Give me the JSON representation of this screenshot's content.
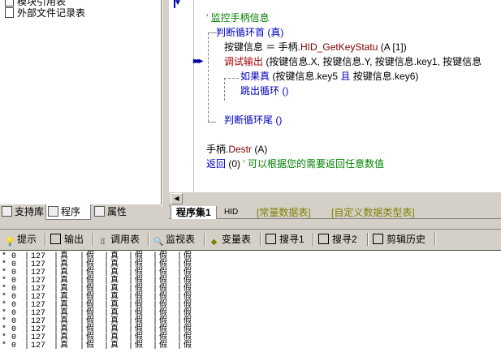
{
  "tree": {
    "items": [
      "模块引用表",
      "外部文件记录表"
    ]
  },
  "left_tabs": [
    {
      "label": "支持库",
      "icon": "support-library-icon"
    },
    {
      "label": "程序",
      "icon": "program-icon"
    },
    {
      "label": "属性",
      "icon": "property-icon"
    }
  ],
  "code": {
    "comment1": "' 监控手柄信息",
    "loop_head": "判断循环首 (真)",
    "line_assign_a": "按键信息 ＝ 手柄.",
    "line_assign_b": "HID_GetKeyStatu",
    "line_assign_c": " (A [1])",
    "debug_a": "调试输出",
    "debug_b": " (按键信息.X, 按键信息.Y, 按键信息.key1, 按键信息",
    "if_a": "如果真",
    "if_b": " (按键信息.key5 ",
    "if_c": "且",
    "if_d": " 按键信息.key6)",
    "break": "跳出循环 ()",
    "loop_tail": "判断循环尾 ()",
    "destr_a": "手柄.",
    "destr_b": "Destr",
    "destr_c": " (A)",
    "ret_a": "返回",
    "ret_b": " (0) ",
    "ret_c": "' 可以根据您的需要返回任意数值"
  },
  "editor_tabs": [
    "程序集1",
    "HID",
    "[常量数据表]",
    "[自定义数据类型表]"
  ],
  "output_tabs": [
    {
      "label": "提示",
      "icon": "bulb-icon"
    },
    {
      "label": "输出",
      "icon": "output-icon"
    },
    {
      "label": "调用表",
      "icon": "call-table-icon"
    },
    {
      "label": "监视表",
      "icon": "magnifier-icon"
    },
    {
      "label": "变量表",
      "icon": "variable-icon"
    },
    {
      "label": "搜寻1",
      "icon": "search1-icon"
    },
    {
      "label": "搜寻2",
      "icon": "search2-icon"
    },
    {
      "label": "剪辑历史",
      "icon": "clip-history-icon"
    }
  ],
  "output_rows": [
    [
      "* 0",
      "127",
      "真",
      "假",
      "真",
      "假",
      "假",
      "假"
    ],
    [
      "* 0",
      "127",
      "真",
      "假",
      "真",
      "假",
      "假",
      "假"
    ],
    [
      "* 0",
      "127",
      "真",
      "假",
      "真",
      "假",
      "假",
      "假"
    ],
    [
      "* 0",
      "127",
      "真",
      "假",
      "真",
      "假",
      "假",
      "假"
    ],
    [
      "* 0",
      "127",
      "真",
      "假",
      "真",
      "假",
      "假",
      "假"
    ],
    [
      "* 0",
      "127",
      "真",
      "假",
      "真",
      "假",
      "假",
      "假"
    ],
    [
      "* 0",
      "127",
      "真",
      "假",
      "真",
      "假",
      "假",
      "假"
    ],
    [
      "* 0",
      "127",
      "真",
      "假",
      "真",
      "假",
      "假",
      "假"
    ],
    [
      "* 0",
      "127",
      "真",
      "假",
      "真",
      "假",
      "假",
      "假"
    ],
    [
      "* 0",
      "127",
      "真",
      "假",
      "真",
      "假",
      "假",
      "假"
    ],
    [
      "* 0",
      "127",
      "真",
      "假",
      "真",
      "假",
      "假",
      "假"
    ],
    [
      "* 0",
      "127",
      "真",
      "假",
      "真",
      "假",
      "假",
      "假"
    ]
  ]
}
